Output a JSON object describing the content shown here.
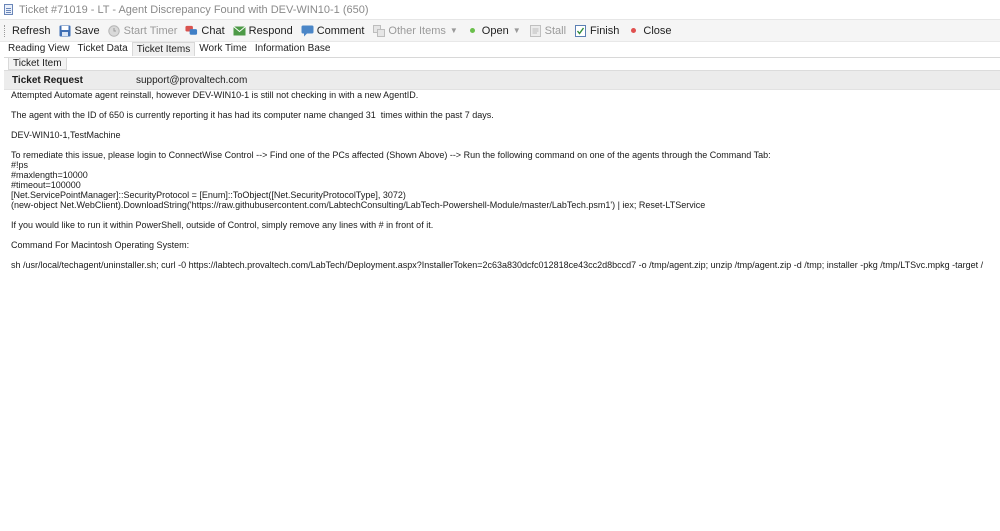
{
  "window": {
    "title": "Ticket #71019 - LT - Agent Discrepancy Found with DEV-WIN10-1 (650)"
  },
  "toolbar": {
    "refresh": "Refresh",
    "save": "Save",
    "start_timer": "Start Timer",
    "chat": "Chat",
    "respond": "Respond",
    "comment": "Comment",
    "other_items": "Other Items",
    "open": "Open",
    "stall": "Stall",
    "finish": "Finish",
    "close": "Close"
  },
  "tabs": [
    {
      "label": "Reading View"
    },
    {
      "label": "Ticket Data"
    },
    {
      "label": "Ticket Items",
      "active": true
    },
    {
      "label": "Work Time"
    },
    {
      "label": "Information Base"
    }
  ],
  "subtab": {
    "label": "Ticket Item"
  },
  "request": {
    "label": "Ticket Request",
    "sender": "support@provaltech.com"
  },
  "body": {
    "l1": "Attempted Automate agent reinstall, however DEV-WIN10-1 is still not checking in with a new AgentID.",
    "l2": "The agent with the ID of 650 is currently reporting it has had its computer name changed 31  times within the past 7 days.",
    "l3": "DEV-WIN10-1,TestMachine",
    "l4": "To remediate this issue, please login to ConnectWise Control --> Find one of the PCs affected (Shown Above) --> Run the following command on one of the agents through the Command Tab:",
    "l5": "#!ps",
    "l6": "#maxlength=10000",
    "l7": "#timeout=100000",
    "l8": "[Net.ServicePointManager]::SecurityProtocol = [Enum]::ToObject([Net.SecurityProtocolType], 3072)",
    "l9": "(new-object Net.WebClient).DownloadString('https://raw.githubusercontent.com/LabtechConsulting/LabTech-Powershell-Module/master/LabTech.psm1') | iex; Reset-LTService",
    "l10": "If you would like to run it within PowerShell, outside of Control, simply remove any lines with # in front of it.",
    "l11": "Command For Macintosh Operating System:",
    "l12": "sh /usr/local/techagent/uninstaller.sh; curl -0 https://labtech.provaltech.com/LabTech/Deployment.aspx?InstallerToken=2c63a830dcfc012818ce43cc2d8bccd7 -o /tmp/agent.zip; unzip /tmp/agent.zip -d /tmp; installer -pkg /tmp/LTSvc.mpkg -target /"
  },
  "colors": {
    "open_dot": "#6abf4b",
    "close_dot": "#e0504f"
  }
}
